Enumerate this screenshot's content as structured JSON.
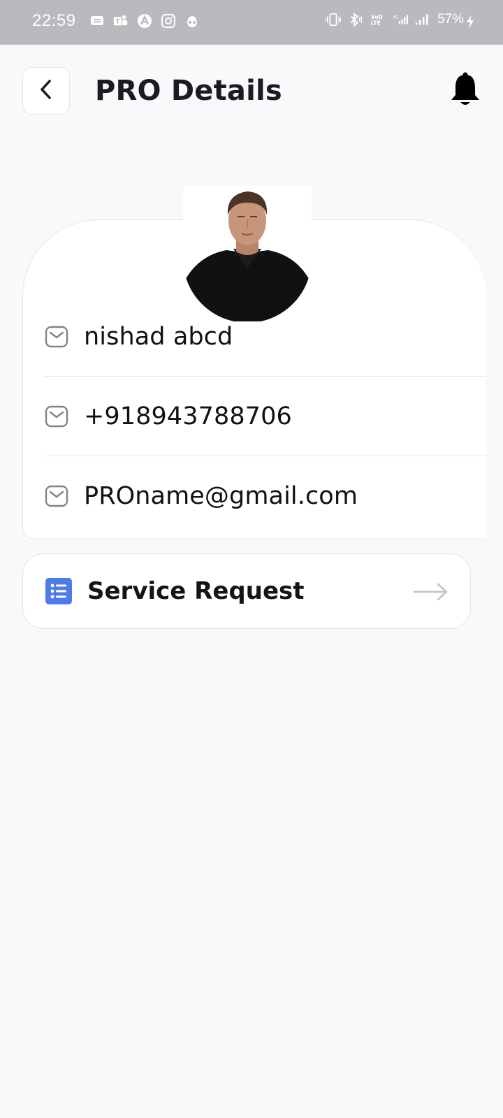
{
  "status_bar": {
    "time": "22:59",
    "battery": "57%",
    "left_icons": [
      "message-icon",
      "teams-icon",
      "arc-icon",
      "instagram-icon",
      "incognito-icon"
    ],
    "right_icons": [
      "vibrate-icon",
      "bluetooth-icon",
      "volte-icon",
      "signal-4g-icon",
      "signal-icon",
      "charging-icon"
    ]
  },
  "header": {
    "title": "PRO Details",
    "back_icon": "chevron-left-icon",
    "bell_icon": "bell-icon"
  },
  "profile": {
    "name": "nishad abcd",
    "phone": "+918943788706",
    "email": "PROname@gmail.com",
    "row_icon": "envelope-icon"
  },
  "actions": {
    "service_request_label": "Service Request",
    "service_request_icon": "list-icon",
    "arrow_icon": "arrow-right-icon"
  },
  "colors": {
    "background": "#f8f9fb",
    "status_bar": "#b9babd",
    "card_border": "#e3e5ea",
    "accent_blue": "#4f7bea",
    "icon_gray": "#8a7f86"
  }
}
